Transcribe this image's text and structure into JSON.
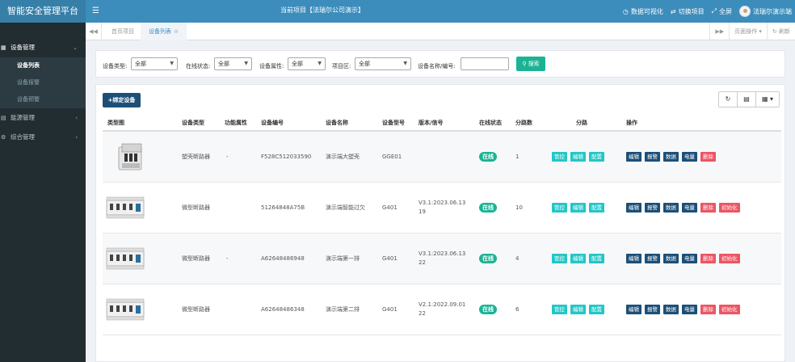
{
  "app": {
    "brand": "智能安全管理平台",
    "project_title": "当前项目【法瑞尔公司演示】",
    "data_viz": "数据可视化",
    "switch_project": "切换项目",
    "fullscreen": "全屏",
    "username": "法瑞尔演示端"
  },
  "sidebar": {
    "device_mgmt": "设备管理",
    "device_list": "设备列表",
    "device_alarm": "设备报警",
    "device_warning": "设备预警",
    "energy_mgmt": "能源管理",
    "general_mgmt": "综合管理"
  },
  "tabs": {
    "tab1": "首页项目",
    "tab2": "设备列表",
    "page_ops": "页面操作",
    "refresh": "刷新"
  },
  "filter": {
    "type_label": "设备类型:",
    "type_value": "全部",
    "status_label": "在线状态:",
    "status_value": "全部",
    "attr_label": "设备属性:",
    "attr_value": "全部",
    "area_label": "项目区:",
    "area_value": "全部",
    "name_label": "设备名称/编号:",
    "name_value": "",
    "search_label": "搜索"
  },
  "toolbar": {
    "add_device": "+绑定设备"
  },
  "table": {
    "headers": [
      "类型图",
      "设备类型",
      "功能属性",
      "设备编号",
      "设备名称",
      "设备型号",
      "版本/信号",
      "在线状态",
      "分路数",
      "分路",
      "操作"
    ],
    "branch_buttons": [
      "管控",
      "编辑",
      "配置"
    ],
    "op_buttons": [
      "编辑",
      "报警",
      "数据",
      "电量",
      "删除",
      "初始化"
    ],
    "rows": [
      {
        "type": "塑壳断路器",
        "attr": "-",
        "code": "F528C512033590",
        "name": "演示端大塑壳",
        "model": "GGE01",
        "version": "",
        "status": "在线",
        "branches": "1",
        "has_init": false,
        "image": "mccb"
      },
      {
        "type": "微型断路器",
        "attr": "",
        "code": "51264848A75B",
        "name": "演示端智能过欠",
        "model": "G401",
        "version": "V3.1:2023.06.13 19",
        "status": "在线",
        "branches": "10",
        "has_init": true,
        "image": "mcb"
      },
      {
        "type": "微型断路器",
        "attr": "-",
        "code": "A62648486948",
        "name": "演示端第一排",
        "model": "G401",
        "version": "V3.1:2023.06.13 22",
        "status": "在线",
        "branches": "4",
        "has_init": true,
        "image": "mcb"
      },
      {
        "type": "微型断路器",
        "attr": "",
        "code": "A62648486348",
        "name": "演示端第二排",
        "model": "G401",
        "version": "V2.1:2022.09.01 22",
        "status": "在线",
        "branches": "6",
        "has_init": true,
        "image": "mcb"
      }
    ]
  },
  "colors": {
    "header_blue": "#3c8dbc",
    "sidebar_dark": "#222d32",
    "teal": "#1ab394",
    "cyan": "#23c6c8",
    "navy": "#1c4f78",
    "red": "#ed5565"
  }
}
